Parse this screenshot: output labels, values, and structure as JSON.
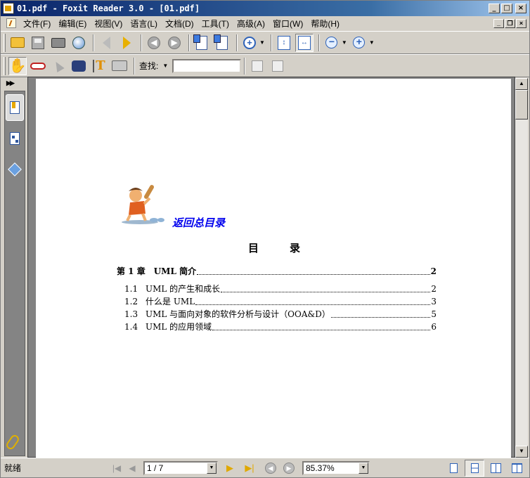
{
  "window": {
    "title": "01.pdf - Foxit Reader 3.0 - [01.pdf]",
    "min_glyph": "_",
    "max_glyph": "□",
    "close_glyph": "×",
    "restore_glyph": "❐"
  },
  "menubar": {
    "items": [
      "文件(F)",
      "编辑(E)",
      "视图(V)",
      "语言(L)",
      "文档(D)",
      "工具(T)",
      "高级(A)",
      "窗口(W)",
      "帮助(H)"
    ]
  },
  "toolbar2": {
    "find_label": "查找:",
    "find_value": ""
  },
  "document": {
    "back_link": "返回总目录",
    "toc_title": "目录",
    "chapter": {
      "num": "第 1 章",
      "title": "UML 简介",
      "page": "2"
    },
    "sections": [
      {
        "num": "1.1",
        "title": "UML 的产生和成长",
        "page": "2"
      },
      {
        "num": "1.2",
        "title": "什么是 UML",
        "page": "3"
      },
      {
        "num": "1.3",
        "title": "UML 与面向对象的软件分析与设计（OOA&D）",
        "page": "5"
      },
      {
        "num": "1.4",
        "title": "UML 的应用领域",
        "page": "6"
      }
    ]
  },
  "statusbar": {
    "status": "就绪",
    "page_value": "1 / 7",
    "zoom_value": "85.37%"
  },
  "icons": {
    "first_page": "first-page-icon",
    "prev_page": "prev-page-icon",
    "next_page": "next-page-icon",
    "last_page": "last-page-icon"
  }
}
